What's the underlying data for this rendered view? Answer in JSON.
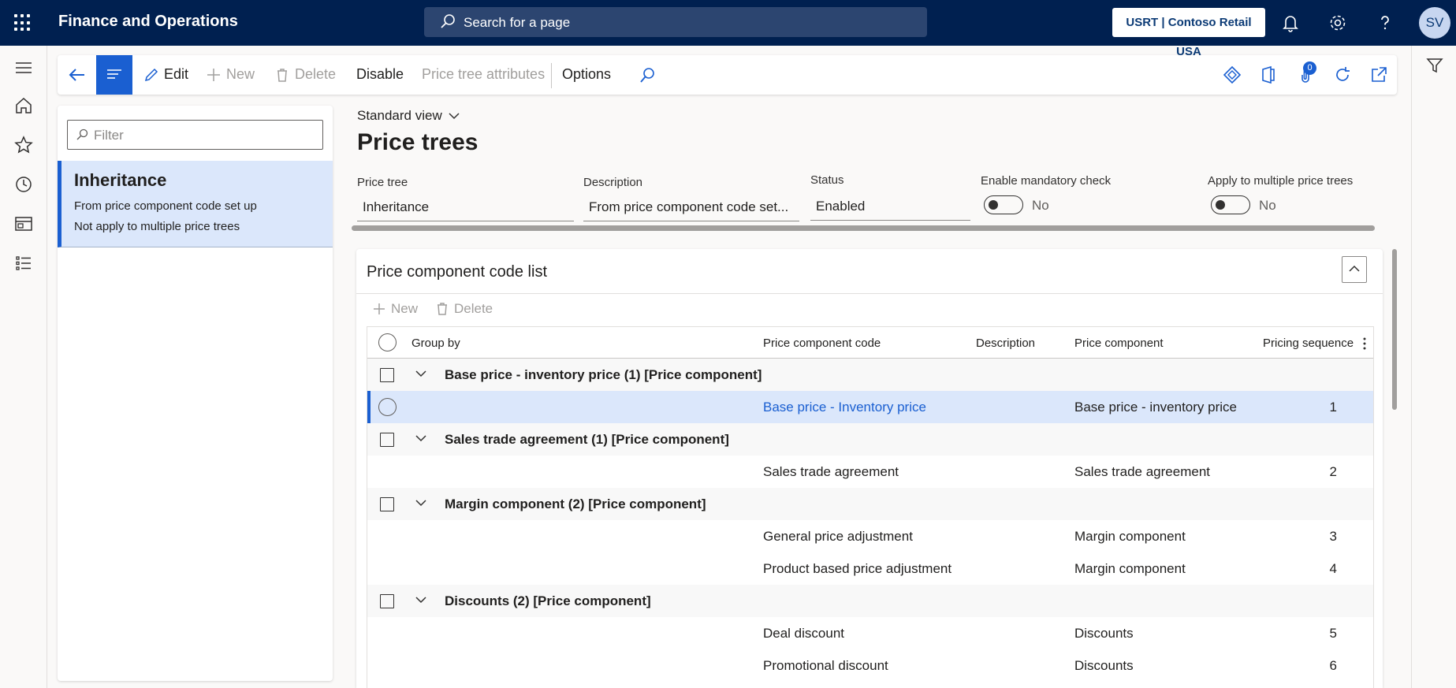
{
  "topbar": {
    "app_title": "Finance and Operations",
    "search_placeholder": "Search for a page",
    "company": "USRT | Contoso Retail USA",
    "user_initials": "SV"
  },
  "actionpane": {
    "edit": "Edit",
    "new": "New",
    "delete": "Delete",
    "disable": "Disable",
    "price_tree_attributes": "Price tree attributes",
    "options": "Options",
    "attachments_count": "0"
  },
  "listpanel": {
    "filter_placeholder": "Filter",
    "items": [
      {
        "title": "Inheritance",
        "line1": "From price component code set up",
        "line2": "Not apply to multiple price trees"
      }
    ]
  },
  "header": {
    "view": "Standard view",
    "title": "Price trees"
  },
  "fields": {
    "price_tree": {
      "label": "Price tree",
      "value": "Inheritance"
    },
    "description": {
      "label": "Description",
      "value": "From price component code set..."
    },
    "status": {
      "label": "Status",
      "value": "Enabled"
    },
    "mandatory_check": {
      "label": "Enable mandatory check",
      "value": "No"
    },
    "multiple_trees": {
      "label": "Apply to multiple price trees",
      "value": "No"
    }
  },
  "section": {
    "title": "Price component code list",
    "new": "New",
    "delete": "Delete"
  },
  "grid": {
    "columns": {
      "group_by": "Group by",
      "code": "Price component code",
      "description": "Description",
      "component": "Price component",
      "sequence": "Pricing sequence"
    },
    "rows": [
      {
        "kind": "group",
        "label": "Base price - inventory price (1) [Price component]"
      },
      {
        "kind": "data",
        "selected": true,
        "code": "Base price - Inventory price",
        "component": "Base price - inventory price",
        "sequence": "1"
      },
      {
        "kind": "group",
        "label": "Sales trade agreement (1) [Price component]"
      },
      {
        "kind": "data",
        "code": "Sales trade agreement",
        "component": "Sales trade agreement",
        "sequence": "2"
      },
      {
        "kind": "group",
        "label": "Margin component (2) [Price component]"
      },
      {
        "kind": "data",
        "code": "General price adjustment",
        "component": "Margin component",
        "sequence": "3"
      },
      {
        "kind": "data",
        "code": "Product based price adjustment",
        "component": "Margin component",
        "sequence": "4"
      },
      {
        "kind": "group",
        "label": "Discounts (2) [Price component]"
      },
      {
        "kind": "data",
        "code": "Deal discount",
        "component": "Discounts",
        "sequence": "5"
      },
      {
        "kind": "data",
        "code": "Promotional discount",
        "component": "Discounts",
        "sequence": "6"
      }
    ]
  },
  "colors": {
    "topbar": "#002050",
    "accent": "#1a5fd1",
    "selected_row": "#dbe7fb"
  }
}
